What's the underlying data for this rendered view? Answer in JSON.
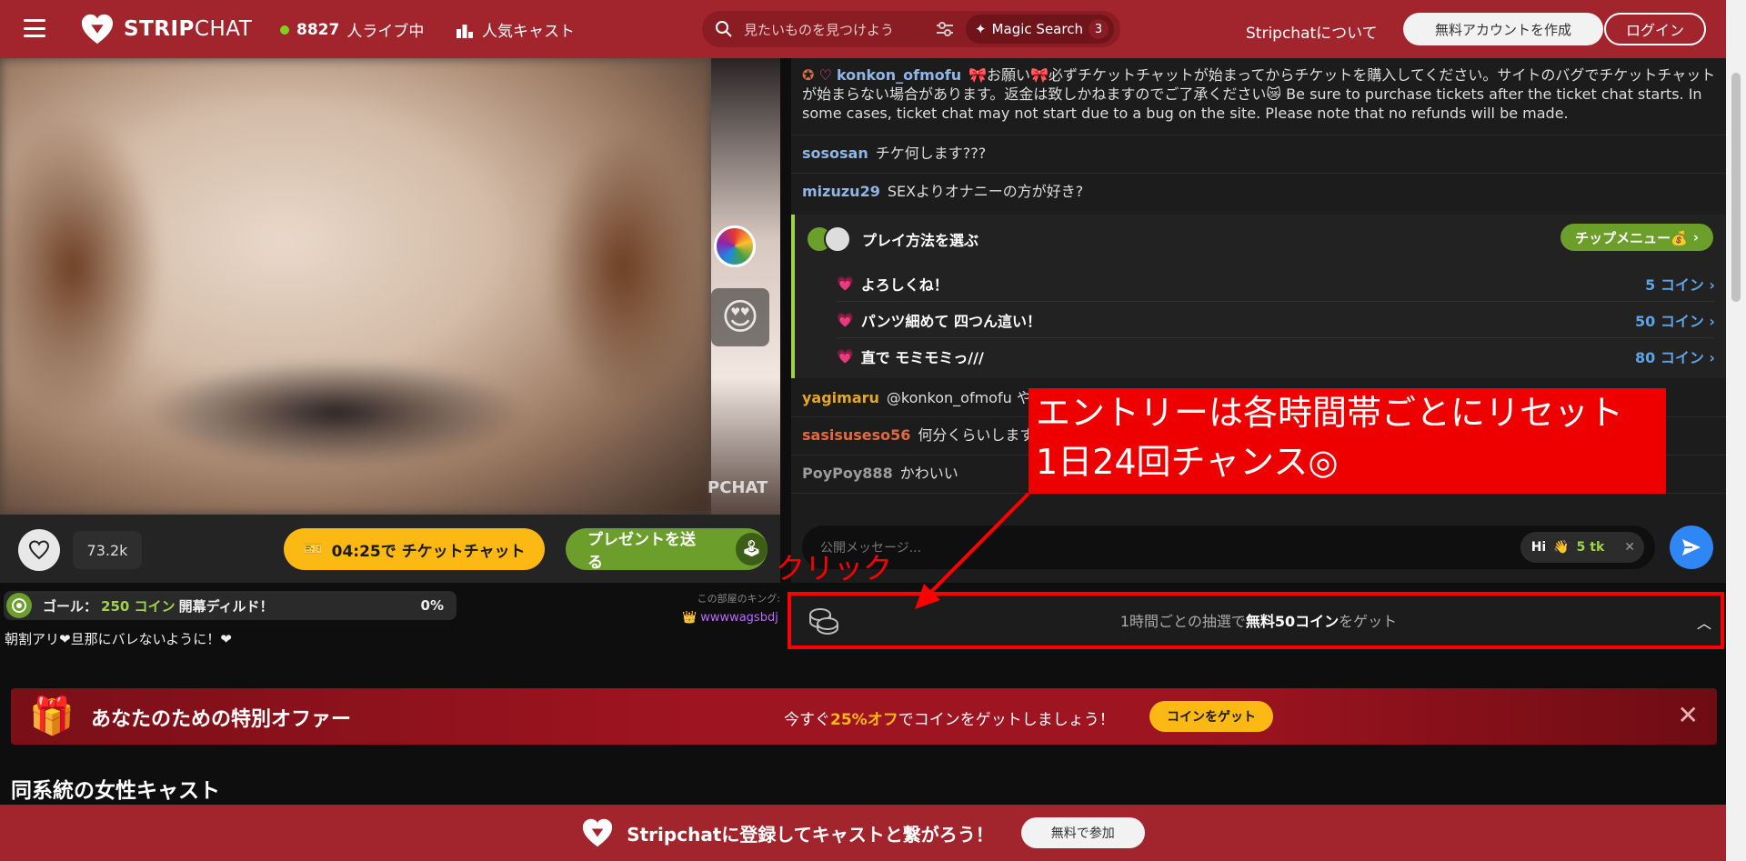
{
  "header": {
    "logo_text_bold": "STRIP",
    "logo_text_light": "CHAT",
    "live_count": "8827",
    "live_suffix": "人ライブ中",
    "popular_label": "人気キャスト",
    "search_placeholder": "見たいものを見つけよう",
    "magic_search_label": "Magic Search",
    "magic_search_badge": "3",
    "about_label": "Stripchatについて",
    "create_account_label": "無料アカウントを作成",
    "login_label": "ログイン",
    "accent_color": "#a2242d"
  },
  "video": {
    "watermark": "PCHAT",
    "likes": "73.2k",
    "ticket_label": "04:25で チケットチャット",
    "gift_label": "プレゼントを送る"
  },
  "goal": {
    "label": "ゴール：",
    "amount": "250 コイン",
    "desc": "開幕ディルド！",
    "percent": "0%"
  },
  "subject": "朝割アリ❤旦那にバレないように！❤",
  "king": {
    "label": "この部屋のキング:",
    "name": "wwwwagsbdj"
  },
  "chat": {
    "messages": [
      {
        "user": "konkon_ofmofu",
        "text": "🎀お願い🎀必ずチケットチャットが始まってからチケットを購入してください。サイトのバグでチケットチャットが始まらない場合があります。返金は致しかねますのでご了承ください😿 Be sure to purchase tickets after the ticket chat starts. In some cases, ticket chat may not start due to a bug on the site. Please note that no refunds will be made."
      },
      {
        "user": "sososan",
        "text": "チケ何します???"
      },
      {
        "user": "mizuzu29",
        "text": "SEXよりオナニーの方が好き?"
      },
      {
        "user": "yagimaru",
        "text": "@konkon_ofmofu やる"
      },
      {
        "user": "sasisuseso56",
        "text": "何分くらいします"
      },
      {
        "user": "PoyPoy888",
        "text": "かわいい"
      }
    ],
    "tip_menu": {
      "title": "プレイ方法を選ぶ",
      "button": "チップメニュー💰",
      "items": [
        {
          "label": "よろしくね！",
          "price": "5 コイン"
        },
        {
          "label": "パンツ細めて 四つん這い！",
          "price": "50 コイン"
        },
        {
          "label": "直で モミモミっ///",
          "price": "80 コイン"
        }
      ]
    },
    "composer_placeholder": "公開メッセージ...",
    "quick_tip_hi": "Hi",
    "quick_tip_amount": "5 tk"
  },
  "lottery": {
    "prefix": "1時間ごとの抽選で",
    "highlight": "無料50コイン",
    "suffix": "をゲット"
  },
  "annotation": {
    "callout_line1": "エントリーは各時間帯ごとにリセット",
    "callout_line2": "1日24回チャンス◎",
    "click_label": "クリック",
    "color": "#ff0000"
  },
  "offer": {
    "title": "あなたのための特別オファー",
    "text_prefix": "今すぐ",
    "text_highlight": "25%オフ",
    "text_suffix": "でコインをゲットしましょう！",
    "button": "コインをゲット"
  },
  "similar_title": "同系統の女性キャスト",
  "footer": {
    "text": "Stripchatに登録してキャストと繋がろう！",
    "button": "無料で参加"
  }
}
